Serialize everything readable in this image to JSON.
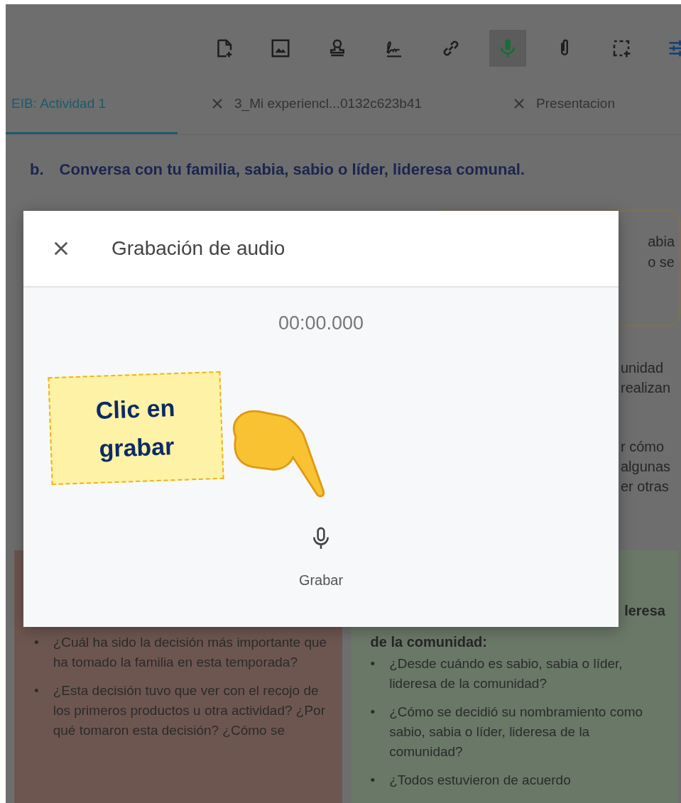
{
  "toolbar": [
    {
      "selected": false
    },
    {
      "selected": false
    },
    {
      "selected": false
    },
    {
      "selected": false
    },
    {
      "selected": false
    },
    {
      "selected": true
    },
    {
      "selected": false
    },
    {
      "selected": false
    },
    {
      "selected": false
    }
  ],
  "tabs": [
    {
      "label": "EIB: Actividad 1",
      "selected": true,
      "closable": false
    },
    {
      "label": "3_Mi experiencl...0132c623b41",
      "selected": false,
      "closable": true
    },
    {
      "label": "Presentacion",
      "selected": false,
      "closable": true
    }
  ],
  "heading": {
    "marker": "b.",
    "text": "Conversa con tu familia, sabia, sabio o líder, lideresa comunal."
  },
  "note_box": {
    "lines": [
      "abia",
      "o se"
    ]
  },
  "side_fragments": [
    [
      "unidad",
      "realizan"
    ],
    [
      "r cómo",
      "algunas",
      "er otras"
    ]
  ],
  "panels": [
    {
      "color": "#6e5650",
      "items": [
        {
          "marker": "•",
          "text": "¿Cuál ha sido la decisión más importante que ha tomado la familia en esta temporada?"
        },
        {
          "marker": "•",
          "text": "¿Esta decisión tuvo que ver con el recojo de los primeros productos u otra actividad? ¿Por qué tomaron esta decisión? ¿Cómo se"
        }
      ]
    },
    {
      "color": "#6a7868",
      "title_lines": [
        "leresa",
        "de la comunidad:"
      ],
      "items": [
        {
          "marker": "•",
          "text": "¿Desde cuándo es sabio, sabia o líder, lideresa de la comunidad?"
        },
        {
          "marker": "•",
          "text": "¿Cómo se decidió su nombramiento  como sabio, sabia o líder, lideresa de la comunidad?"
        },
        {
          "marker": "•",
          "text": "¿Todos estuvieron de acuerdo"
        }
      ]
    }
  ],
  "modal": {
    "title": "Grabación de audio",
    "timer": "00:00.000",
    "record_label": "Grabar"
  },
  "callout": {
    "lines": [
      "Clic en",
      "grabar"
    ]
  }
}
